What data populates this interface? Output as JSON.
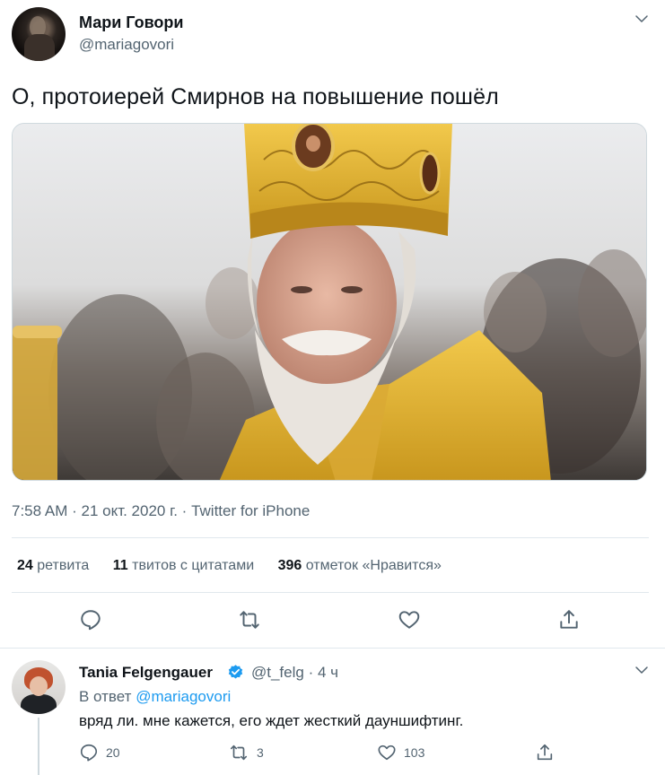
{
  "tweet": {
    "author_name": "Мари Говори",
    "author_handle": "@mariagovori",
    "text": "О, протоиерей Смирнов на повышение пошёл",
    "time": "7:58 AM",
    "date": "21 окт. 2020 г.",
    "source": "Twitter for iPhone",
    "separator": " · "
  },
  "stats": {
    "retweets_count": "24",
    "retweets_label": "ретвита",
    "quotes_count": "11",
    "quotes_label": "твитов с цитатами",
    "likes_count": "396",
    "likes_label": "отметок «Нравится»"
  },
  "actions": {
    "reply_icon": "speech-bubble-icon",
    "retweet_icon": "retweet-icon",
    "like_icon": "heart-icon",
    "share_icon": "share-icon"
  },
  "reply": {
    "author_name": "Tania Felgengauer",
    "author_handle": "@t_felg",
    "time": "4 ч",
    "replying_label": "В ответ",
    "replying_to": "@mariagovori",
    "text": "вряд ли. мне кажется, его ждет жесткий дауншифтинг.",
    "reply_count": "20",
    "retweet_count": "3",
    "like_count": "103"
  },
  "colors": {
    "text": "#0f1419",
    "secondary": "#536471",
    "link": "#1d9bf0",
    "divider": "#e1e8ed"
  }
}
